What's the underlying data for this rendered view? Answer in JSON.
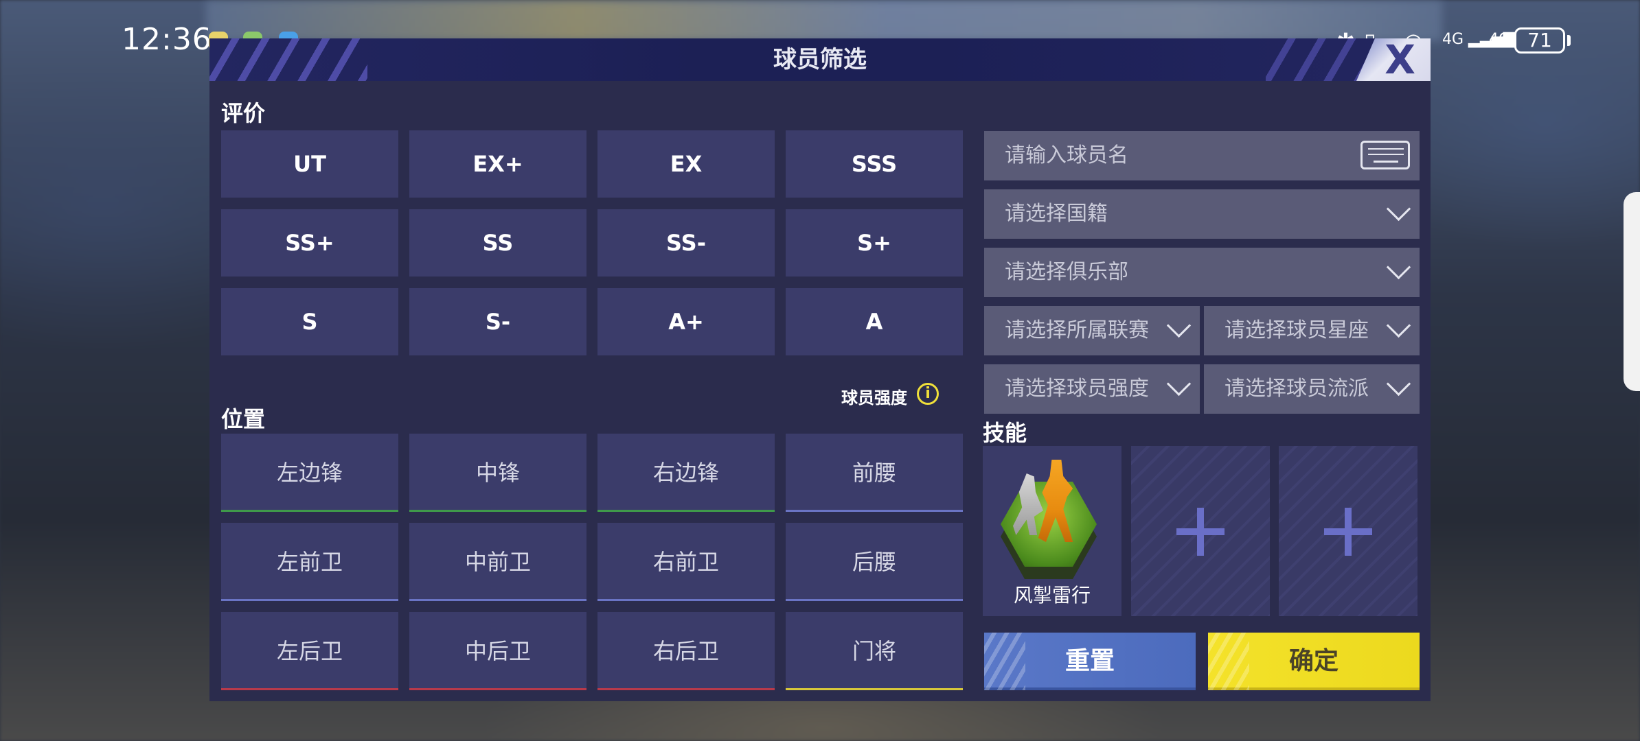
{
  "status_bar": {
    "time": "12:36",
    "network_1": "4G",
    "network_2": "4G",
    "battery": "71"
  },
  "dialog": {
    "title": "球员筛选",
    "close_label": "X"
  },
  "rating": {
    "label": "评价",
    "options": [
      "UT",
      "EX+",
      "EX",
      "SSS",
      "SS+",
      "SS",
      "SS-",
      "S+",
      "S",
      "S-",
      "A+",
      "A"
    ]
  },
  "strength": {
    "label": "球员强度",
    "info_glyph": "i"
  },
  "position": {
    "label": "位置",
    "options": [
      {
        "label": "左边锋",
        "color": "#3f9a4a"
      },
      {
        "label": "中锋",
        "color": "#3f9a4a"
      },
      {
        "label": "右边锋",
        "color": "#3f9a4a"
      },
      {
        "label": "前腰",
        "color": "#6a74c4"
      },
      {
        "label": "左前卫",
        "color": "#6a74c4"
      },
      {
        "label": "中前卫",
        "color": "#6a74c4"
      },
      {
        "label": "右前卫",
        "color": "#6a74c4"
      },
      {
        "label": "后腰",
        "color": "#6a74c4"
      },
      {
        "label": "左后卫",
        "color": "#b83a4a"
      },
      {
        "label": "中后卫",
        "color": "#b83a4a"
      },
      {
        "label": "右后卫",
        "color": "#b83a4a"
      },
      {
        "label": "门将",
        "color": "#d8c83a"
      }
    ]
  },
  "filters": {
    "name_placeholder": "请输入球员名",
    "nationality": "请选择国籍",
    "club": "请选择俱乐部",
    "league": "请选择所属联赛",
    "constellation": "请选择球员星座",
    "strength": "请选择球员强度",
    "style": "请选择球员流派"
  },
  "skills": {
    "label": "技能",
    "slot1_name": "风掣雷行"
  },
  "actions": {
    "reset": "重置",
    "confirm": "确定"
  },
  "colors": {
    "panel": "#2b2c4d",
    "button": "#3b3c6a",
    "field": "#5a5b77",
    "accent_blue": "#5a78c8",
    "accent_yellow": "#f4e22a"
  }
}
